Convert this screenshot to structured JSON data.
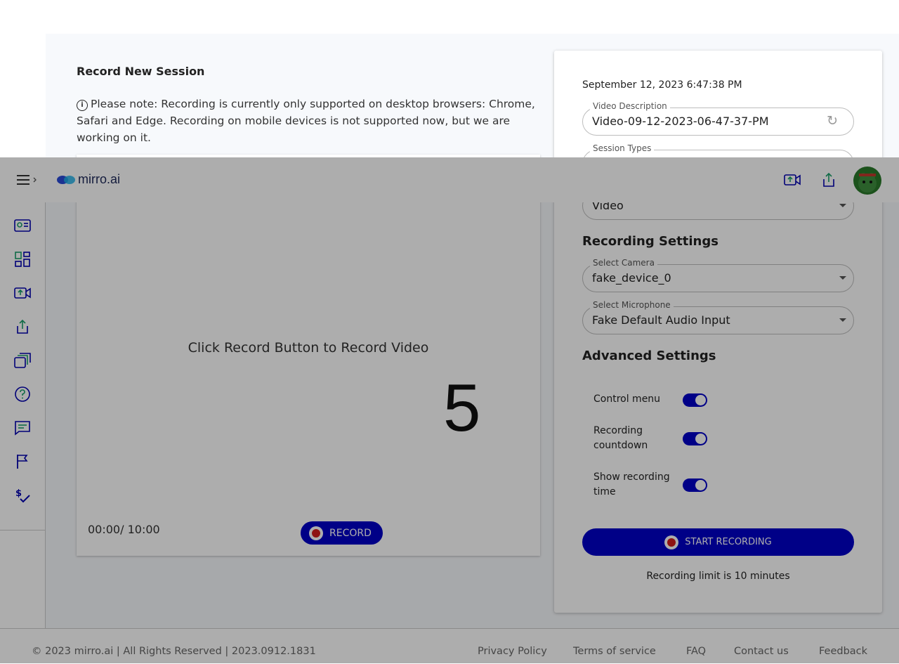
{
  "page": {
    "title": "Record New Session",
    "note": "Please note: Recording is currently only supported on desktop browsers: Chrome, Safari and Edge. Recording on mobile devices is not supported now, but we are working on it."
  },
  "video": {
    "hint": "Click Record Button to Record Video",
    "countdown": "5",
    "timer": "00:00/ 10:00",
    "record_label": "RECORD"
  },
  "settings": {
    "datetime": "September 12, 2023 6:47:38 PM",
    "description_label": "Video Description",
    "description_value": "Video-09-12-2023-06-47-37-PM",
    "session_types_label": "Session Types",
    "session_type_value": "Video",
    "recording_heading": "Recording Settings",
    "camera_label": "Select Camera",
    "camera_value": "fake_device_0",
    "mic_label": "Select Microphone",
    "mic_value": "Fake Default Audio Input",
    "advanced_heading": "Advanced Settings",
    "toggles": [
      {
        "label": "Control menu",
        "on": true
      },
      {
        "label": "Recording countdown",
        "on": true
      },
      {
        "label": "Show recording time",
        "on": true
      }
    ],
    "start_label": "START RECORDING",
    "limit_text": "Recording limit is 10 minutes"
  },
  "header": {
    "logo_text": "mirro.ai",
    "icons": [
      "menu-icon",
      "upload-video-icon",
      "share-icon",
      "avatar"
    ]
  },
  "sidebar": {
    "icons": [
      "dashboard-card-icon",
      "grid-icon",
      "upload-video-icon",
      "share-icon",
      "library-icon",
      "help-icon",
      "chat-icon",
      "flag-icon",
      "billing-icon"
    ]
  },
  "footer": {
    "copyright": "© 2023 mirro.ai | All Rights Reserved | 2023.0912.1831",
    "links": [
      "Privacy Policy",
      "Terms of service",
      "FAQ",
      "Contact us",
      "Feedback"
    ]
  },
  "colors": {
    "accent": "#0000c8",
    "record_red": "#d21d1d",
    "overlay": "rgba(0,0,0,0.32)"
  }
}
